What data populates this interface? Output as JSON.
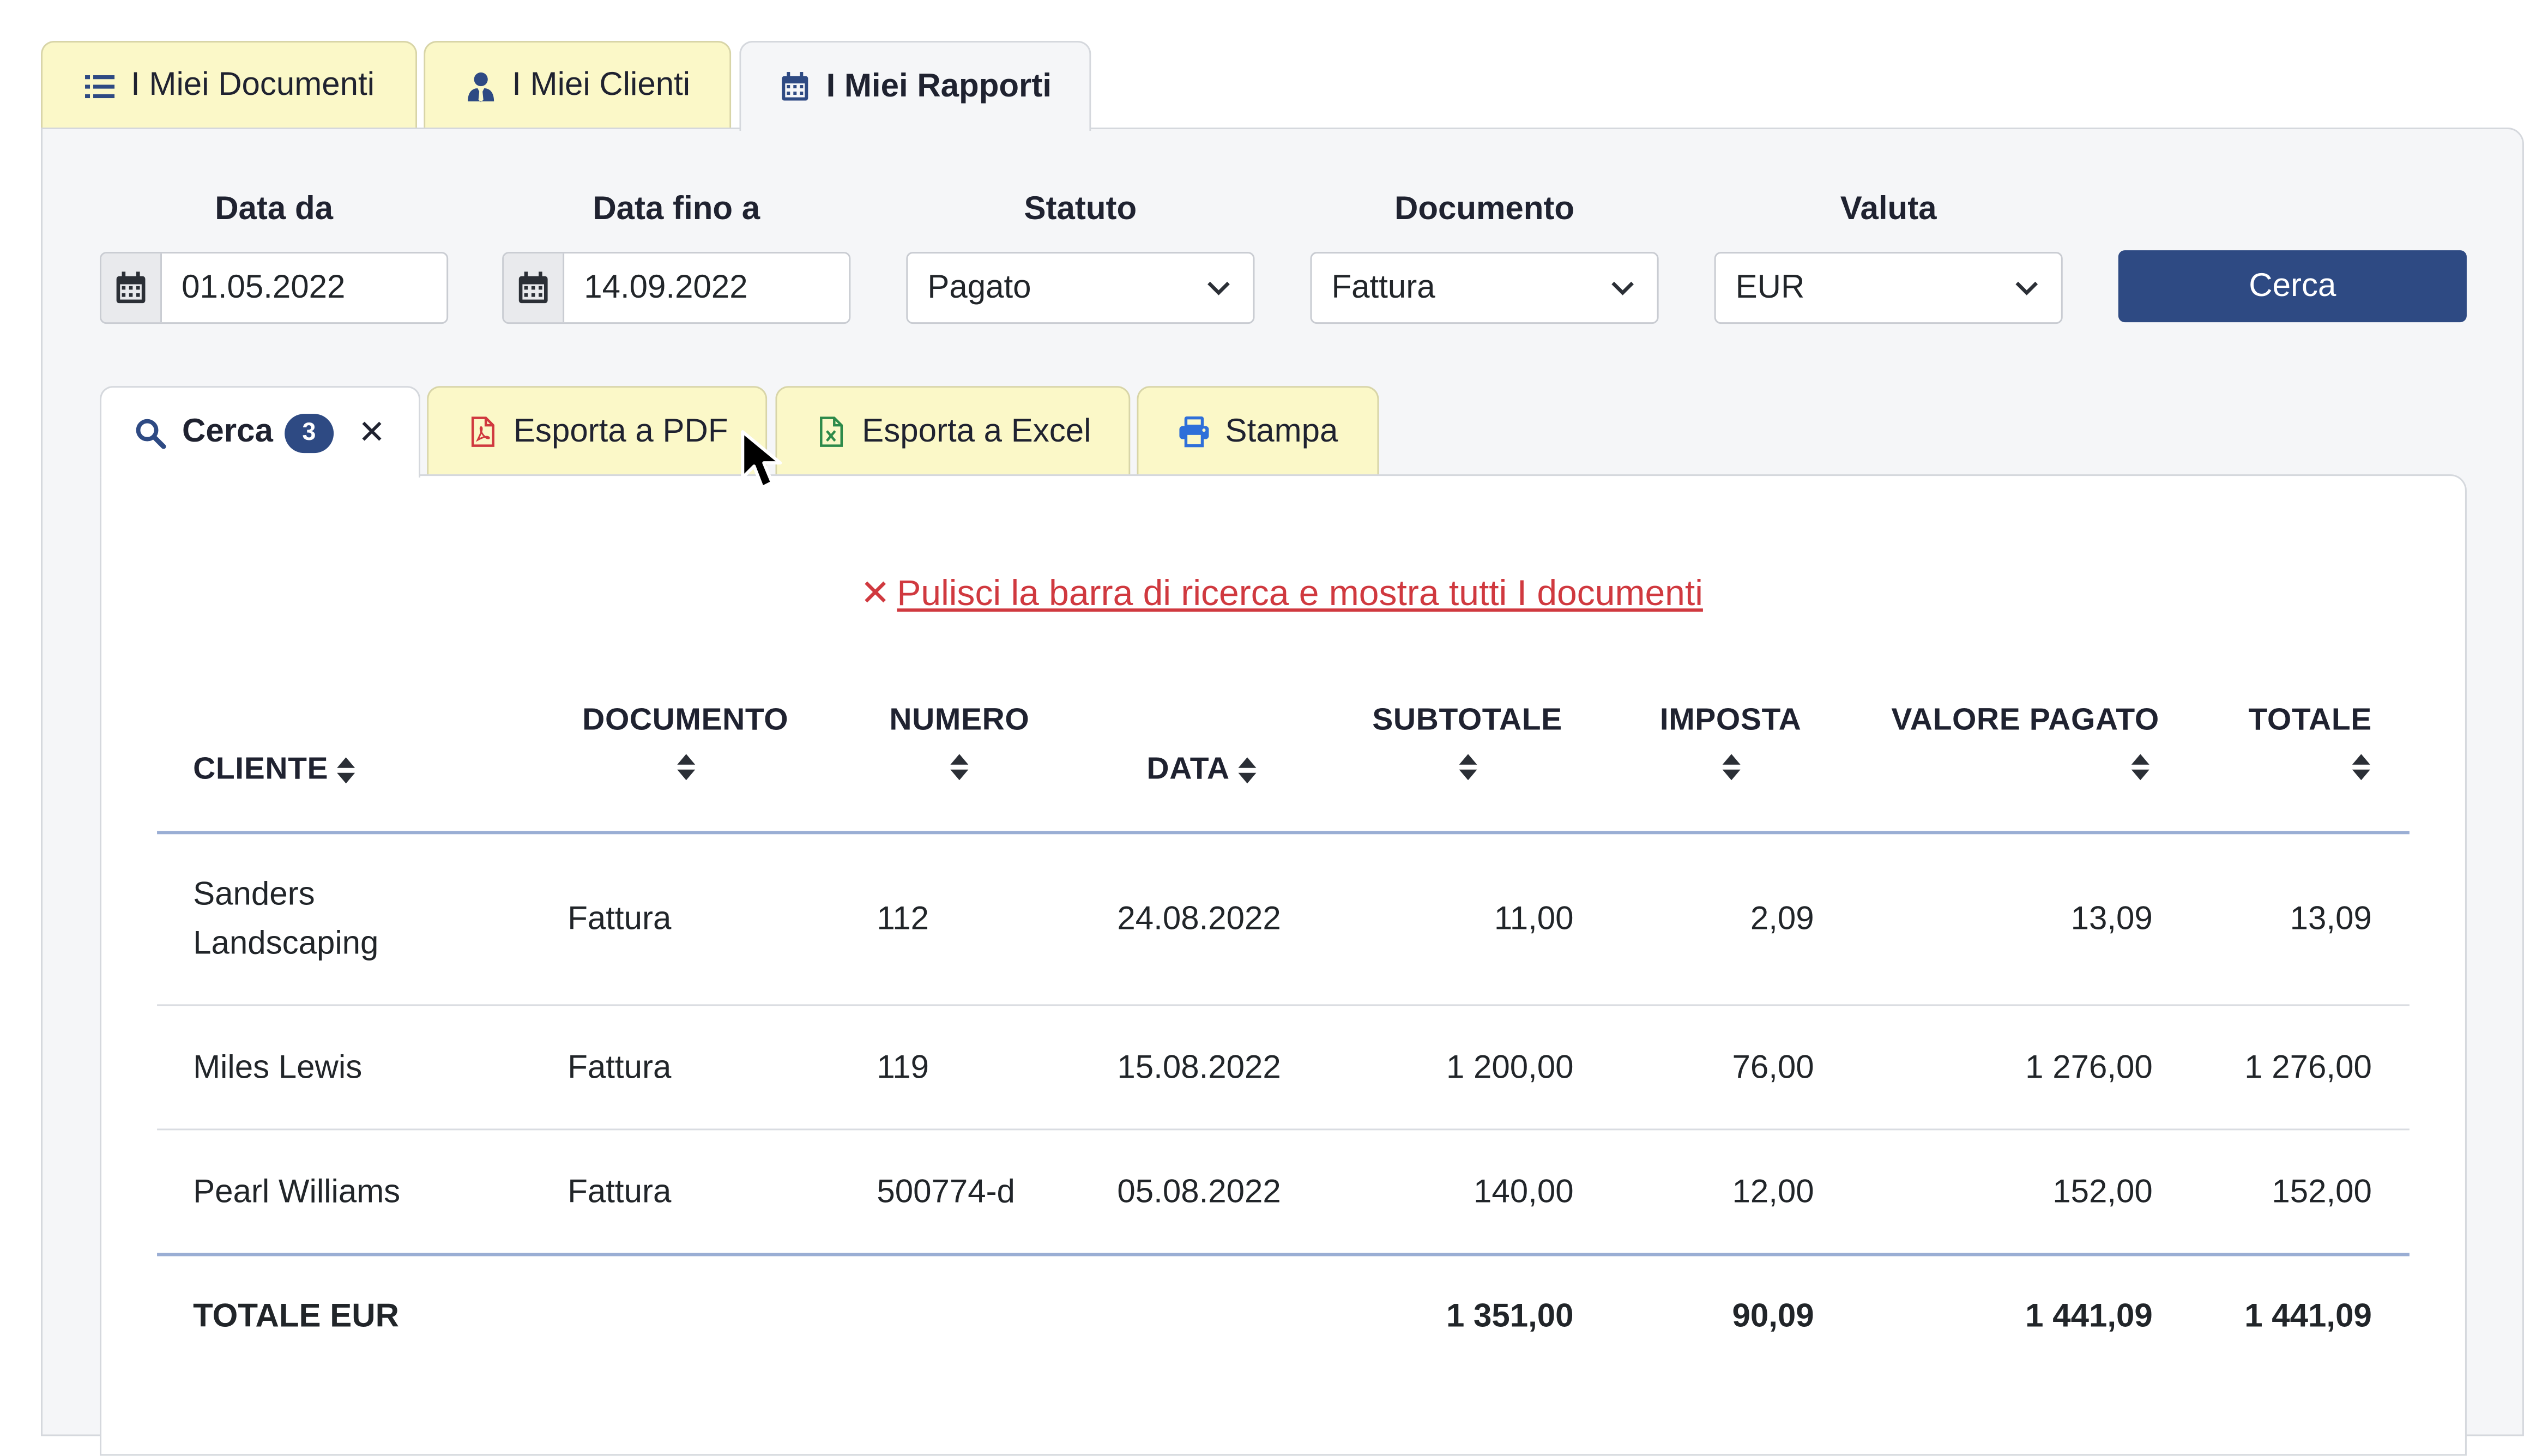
{
  "top_tabs": [
    {
      "label": "I Miei Documenti",
      "icon": "list-icon"
    },
    {
      "label": "I Miei Clienti",
      "icon": "user-tie-icon"
    },
    {
      "label": "I Miei Rapporti",
      "icon": "calendar-icon",
      "active": true
    }
  ],
  "filters": {
    "date_from": {
      "label": "Data da",
      "value": "01.05.2022"
    },
    "date_to": {
      "label": "Data fino a",
      "value": "14.09.2022"
    },
    "status": {
      "label": "Statuto",
      "value": "Pagato"
    },
    "document": {
      "label": "Documento",
      "value": "Fattura"
    },
    "currency": {
      "label": "Valuta",
      "value": "EUR"
    },
    "search_button": "Cerca"
  },
  "inner_tabs": {
    "search": {
      "label": "Cerca",
      "badge": "3",
      "close": "✕"
    },
    "pdf": {
      "label": "Esporta a PDF"
    },
    "excel": {
      "label": "Esporta a Excel"
    },
    "print": {
      "label": "Stampa"
    }
  },
  "clear_link": "Pulisci la barra di ricerca e mostra tutti I documenti",
  "table": {
    "headers": {
      "cliente": "CLIENTE",
      "documento": "DOCUMENTO",
      "numero": "NUMERO",
      "data": "DATA",
      "subtotale": "SUBTOTALE",
      "imposta": "IMPOSTA",
      "valore_pagato": "VALORE PAGATO",
      "totale": "TOTALE"
    },
    "rows": [
      {
        "cliente_1": "Sanders",
        "cliente_2": "Landscaping",
        "documento": "Fattura",
        "numero": "112",
        "data": "24.08.2022",
        "subtotale": "11,00",
        "imposta": "2,09",
        "valore_pagato": "13,09",
        "totale": "13,09"
      },
      {
        "cliente_1": "Miles Lewis",
        "documento": "Fattura",
        "numero": "119",
        "data": "15.08.2022",
        "subtotale": "1 200,00",
        "imposta": "76,00",
        "valore_pagato": "1 276,00",
        "totale": "1 276,00"
      },
      {
        "cliente_1": "Pearl Williams",
        "documento": "Fattura",
        "numero": "500774-d",
        "data": "05.08.2022",
        "subtotale": "140,00",
        "imposta": "12,00",
        "valore_pagato": "152,00",
        "totale": "152,00"
      }
    ],
    "footer": {
      "label": "TOTALE EUR",
      "subtotale": "1 351,00",
      "imposta": "90,09",
      "valore_pagato": "1 441,09",
      "totale": "1 441,09"
    }
  },
  "colors": {
    "primary": "#2e4a83",
    "tab_yellow": "#fbf8c8",
    "danger": "#d0393f"
  }
}
